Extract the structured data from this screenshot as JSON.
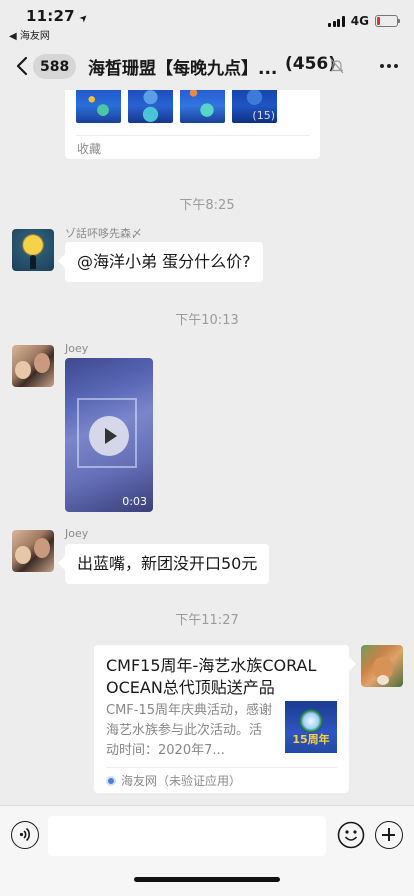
{
  "status_bar": {
    "time": "11:27",
    "location_arrow": "➤",
    "back_app": "◀ 海友网",
    "network": "4G",
    "battery_level": 0.18,
    "battery_color": "#e5322d"
  },
  "nav": {
    "back_icon": "chevron-left-icon",
    "unread_count": "588",
    "title": "海皙珊盟【每晚九点】...",
    "member_count": "(456)",
    "mute_icon": "bell-muted-icon",
    "more_icon": "more-dots-icon"
  },
  "messages": {
    "favorite_card": {
      "more_count": "(15)",
      "label": "收藏"
    },
    "timestamp_1": "下午8:25",
    "msg1": {
      "sender": "ゾ話吥哆先森〆",
      "text": "@海洋小弟 蛋分什么价?"
    },
    "timestamp_2": "下午10:13",
    "msg2": {
      "sender": "Joey",
      "video_duration": "0:03"
    },
    "msg3": {
      "sender": "Joey",
      "text": "出蓝嘴，新团没开口50元"
    },
    "timestamp_3": "下午11:27",
    "link_card": {
      "title": "CMF15周年-海艺水族CORAL OCEAN总代顶贴送产品",
      "description": "CMF-15周年庆典活动，感谢海艺水族参与此次活动。活动时间：2020年7...",
      "thumb_text": "15周年",
      "source": "海友网（未验证应用）"
    }
  },
  "input_bar": {
    "voice_icon": "voice-icon",
    "emoji_icon": "emoji-icon",
    "plus_icon": "plus-icon"
  }
}
